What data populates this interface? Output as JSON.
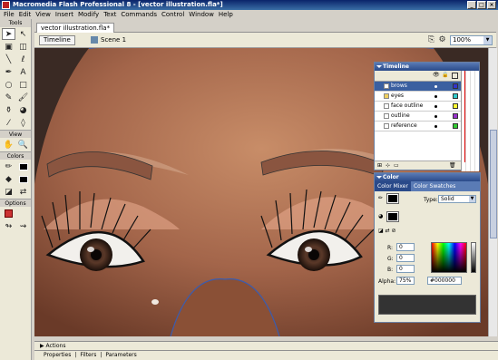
{
  "window": {
    "title": "Macromedia Flash Professional 8 - [vector illustration.fla*]",
    "buttons": [
      "_",
      "□",
      "×"
    ]
  },
  "menu": [
    "File",
    "Edit",
    "View",
    "Insert",
    "Modify",
    "Text",
    "Commands",
    "Control",
    "Window",
    "Help"
  ],
  "tools": {
    "title": "Tools",
    "view_label": "View",
    "colors_label": "Colors",
    "options_label": "Options"
  },
  "document": {
    "tab": "vector illustration.fla*",
    "timeline_button": "Timeline",
    "scene": "Scene 1",
    "zoom": "100%"
  },
  "timeline_panel": {
    "title": "Timeline",
    "layers": [
      {
        "name": "brows",
        "color": "#3333cc",
        "selected": true
      },
      {
        "name": "eyes",
        "color": "#33cccc"
      },
      {
        "name": "face outline",
        "color": "#ffff33"
      },
      {
        "name": "outline",
        "color": "#9933cc"
      },
      {
        "name": "reference",
        "color": "#33cc33"
      }
    ]
  },
  "color_panel": {
    "title": "Color",
    "tabs": [
      "Color Mixer",
      "Color Swatches"
    ],
    "type_label": "Type:",
    "type_value": "Solid",
    "r_label": "R:",
    "r_value": "0",
    "g_label": "G:",
    "g_value": "0",
    "b_label": "B:",
    "b_value": "0",
    "alpha_label": "Alpha:",
    "alpha_value": "75%",
    "hex_value": "#000000"
  },
  "bottom_panels": {
    "actions": "Actions",
    "properties": "Properties",
    "filters": "Filters",
    "parameters": "Parameters"
  }
}
